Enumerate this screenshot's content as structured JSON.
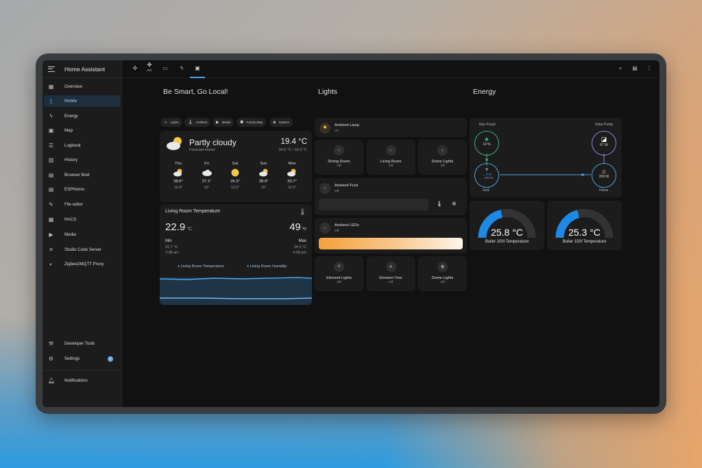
{
  "sidebar": {
    "title": "Home Assistant",
    "items": [
      {
        "label": "Overview",
        "icon": "dashboard-icon"
      },
      {
        "label": "Mobile",
        "icon": "mobile-icon"
      },
      {
        "label": "Energy",
        "icon": "lightning-icon"
      },
      {
        "label": "Map",
        "icon": "map-icon"
      },
      {
        "label": "Logbook",
        "icon": "logbook-icon"
      },
      {
        "label": "History",
        "icon": "history-icon"
      },
      {
        "label": "Browser Mod",
        "icon": "browser-icon"
      },
      {
        "label": "ESPHome",
        "icon": "esphome-icon"
      },
      {
        "label": "File editor",
        "icon": "wrench-icon"
      },
      {
        "label": "HACS",
        "icon": "hacs-icon"
      },
      {
        "label": "Media",
        "icon": "media-icon"
      },
      {
        "label": "Studio Code Server",
        "icon": "vscode-icon"
      },
      {
        "label": "Zigbee2MQTT Proxy",
        "icon": "zigbee-icon"
      }
    ],
    "developer_tools": "Developer Tools",
    "settings": "Settings",
    "settings_badge": "1",
    "notifications": "Notifications"
  },
  "topbar": {
    "tab_ac_label": "A/C",
    "icons": [
      "fan-icon",
      "ac-icon",
      "tv-icon",
      "lightning-icon",
      "monitor-icon",
      "search-icon",
      "chat-icon",
      "more-icon"
    ]
  },
  "columns": {
    "left": "Be Smart, Go Local!",
    "middle": "Lights",
    "right": "Energy"
  },
  "chips": [
    "Lights",
    "Ambient",
    "Media",
    "Family Map",
    "System"
  ],
  "weather": {
    "condition": "Partly cloudy",
    "location": "Forecast Home",
    "temp": "19.4 °C",
    "range": "28.6 °C / 19.4 °C",
    "forecast": [
      {
        "day": "Thu",
        "high": "28.6°",
        "low": "19.4°",
        "icon": "partly-cloudy-icon"
      },
      {
        "day": "Fri",
        "high": "27.1°",
        "low": "16°",
        "icon": "cloudy-icon"
      },
      {
        "day": "Sat",
        "high": "25.3°",
        "low": "12.6°",
        "icon": "sunny-icon"
      },
      {
        "day": "Sun",
        "high": "28.9°",
        "low": "16°",
        "icon": "partly-cloudy-icon"
      },
      {
        "day": "Mon",
        "high": "23.7°",
        "low": "16.3°",
        "icon": "partly-cloudy-icon"
      }
    ]
  },
  "living_room": {
    "title": "Living Room Temperature",
    "temp": "22.9",
    "temp_unit": "°C",
    "humidity": "49",
    "humidity_unit": "%",
    "min_label": "Min",
    "min_val": "22.7 °C",
    "min_time": "7:08 am",
    "max_label": "Max",
    "max_val": "24.3 °C",
    "max_time": "4:08 pm",
    "legend_temp": "Living Room Temperature",
    "legend_hum": "Living Room Humidity"
  },
  "lights": {
    "ambient_lamp": {
      "name": "Ambient Lamp",
      "state": "On"
    },
    "tiles_row1": [
      {
        "name": "Dining Room",
        "state": "Off"
      },
      {
        "name": "Living Room",
        "state": "Off"
      },
      {
        "name": "Dome Lights",
        "state": "Off"
      }
    ],
    "ambient_puck": {
      "name": "Ambient Puck",
      "state": "Off"
    },
    "ambient_leds": {
      "name": "Ambient LEDs",
      "state": "Off"
    },
    "tiles_row2": [
      {
        "name": "Element Lights",
        "state": "Off"
      },
      {
        "name": "Element Tree",
        "state": "Off"
      },
      {
        "name": "Dome Lights",
        "state": "Off"
      }
    ]
  },
  "energy": {
    "non_fossil_label": "Non Fossil",
    "non_fossil_val": "14 %",
    "solar_label": "Solar Pump",
    "solar_val": "67 W",
    "grid_in": "→ 0 W",
    "grid_out": "← 209 W",
    "grid_label": "Grid",
    "home_val": "209 W",
    "home_label": "Home",
    "gauges": [
      {
        "value": "25.8 °C",
        "label": "Boiler 100l Temperature",
        "fraction": 0.43
      },
      {
        "value": "25.3 °C",
        "label": "Boiler 150l Temperature",
        "fraction": 0.42
      }
    ]
  },
  "colors": {
    "accent": "#4aa5e8",
    "gauge_blue": "#1e88e5",
    "solar": "#9a7ee0",
    "home": "#43a047",
    "grid": "#4aa5e8"
  }
}
